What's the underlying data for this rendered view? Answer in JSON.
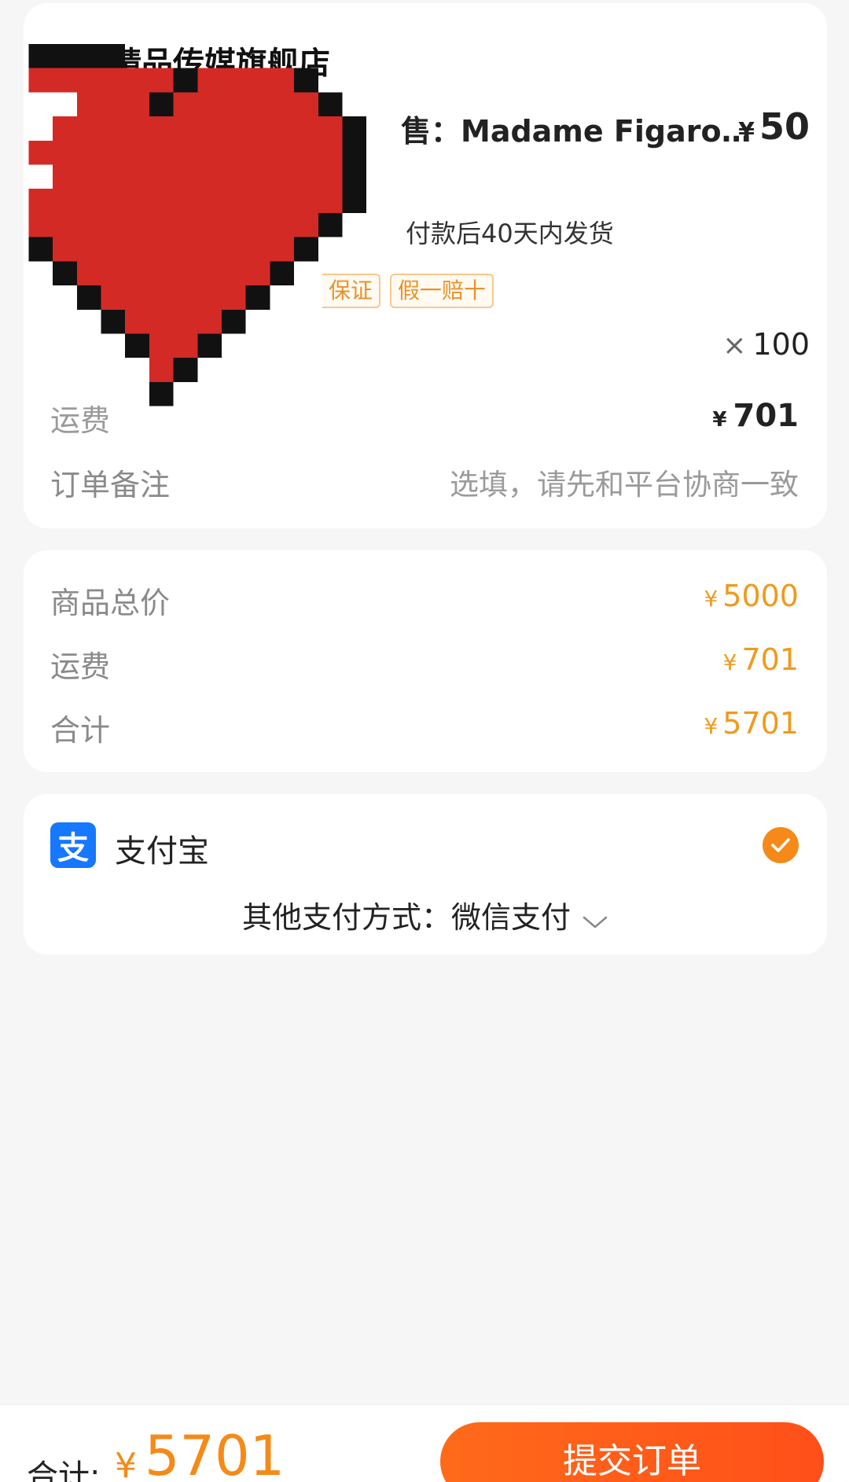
{
  "order": {
    "shop_name": "精品传媒旗舰店",
    "product_title": "售：Madame Figaro7…",
    "price_currency": "¥",
    "price_value": "50",
    "ship_note": "付款后40天内发货",
    "tags": [
      "保证",
      "假一赔十"
    ],
    "quantity_symbol": "×",
    "quantity": "100",
    "freight_label": "运费",
    "freight_currency": "¥",
    "freight_value": "701",
    "remark_label": "订单备注",
    "remark_placeholder": "选填，请先和平台协商一致"
  },
  "summary": {
    "rows": [
      {
        "label": "商品总价",
        "currency": "¥",
        "value": "5000"
      },
      {
        "label": "运费",
        "currency": "¥",
        "value": "701"
      },
      {
        "label": "合计",
        "currency": "¥",
        "value": "5701"
      }
    ]
  },
  "payment": {
    "alipay_icon_glyph": "支",
    "alipay_label": "支付宝",
    "alipay_selected": true,
    "other_label": "其他支付方式：微信支付",
    "icons": {
      "alipay": "alipay-icon",
      "check": "check-circle-icon",
      "chevron": "chevron-down-icon"
    }
  },
  "bottom_bar": {
    "total_label": "合计:",
    "total_currency": "¥",
    "total_value": "5701",
    "submit_label": "提交订单"
  },
  "colors": {
    "accent": "#f58a18",
    "submit_gradient_start": "#ff6a1a",
    "submit_gradient_end": "#ff4f1a",
    "alipay_blue": "#1677ff",
    "background": "#f6f6f6"
  }
}
